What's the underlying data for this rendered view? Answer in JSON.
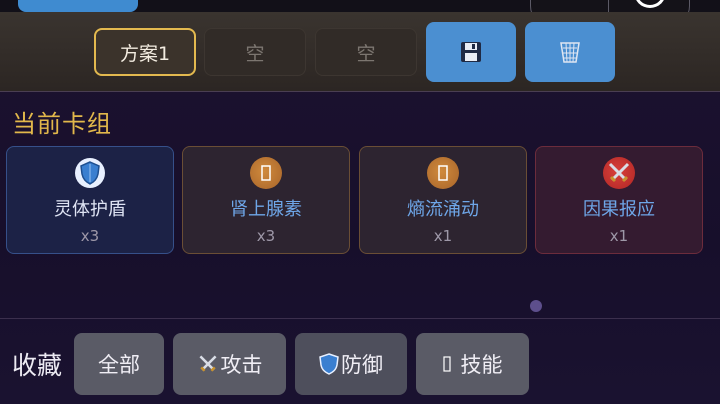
{
  "plans": {
    "slots": [
      {
        "label": "方案1",
        "active": true
      },
      {
        "label": "空",
        "active": false
      },
      {
        "label": "空",
        "active": false
      }
    ],
    "save_icon": "save-icon",
    "delete_icon": "trash-icon"
  },
  "deck": {
    "title": "当前卡组",
    "cards": [
      {
        "name": "灵体护盾",
        "count": "x3",
        "icon": "shield-icon"
      },
      {
        "name": "肾上腺素",
        "count": "x3",
        "icon": "missing-glyph-icon"
      },
      {
        "name": "熵流涌动",
        "count": "x1",
        "icon": "missing-glyph-icon"
      },
      {
        "name": "因果报应",
        "count": "x1",
        "icon": "crossed-swords-icon"
      }
    ]
  },
  "collection": {
    "label": "收藏",
    "filters": [
      {
        "label": "全部",
        "icon": ""
      },
      {
        "label": "攻击",
        "icon": "crossed-swords-icon"
      },
      {
        "label": "防御",
        "icon": "shield-icon"
      },
      {
        "label": "技能",
        "icon": "missing-glyph-icon"
      }
    ]
  }
}
